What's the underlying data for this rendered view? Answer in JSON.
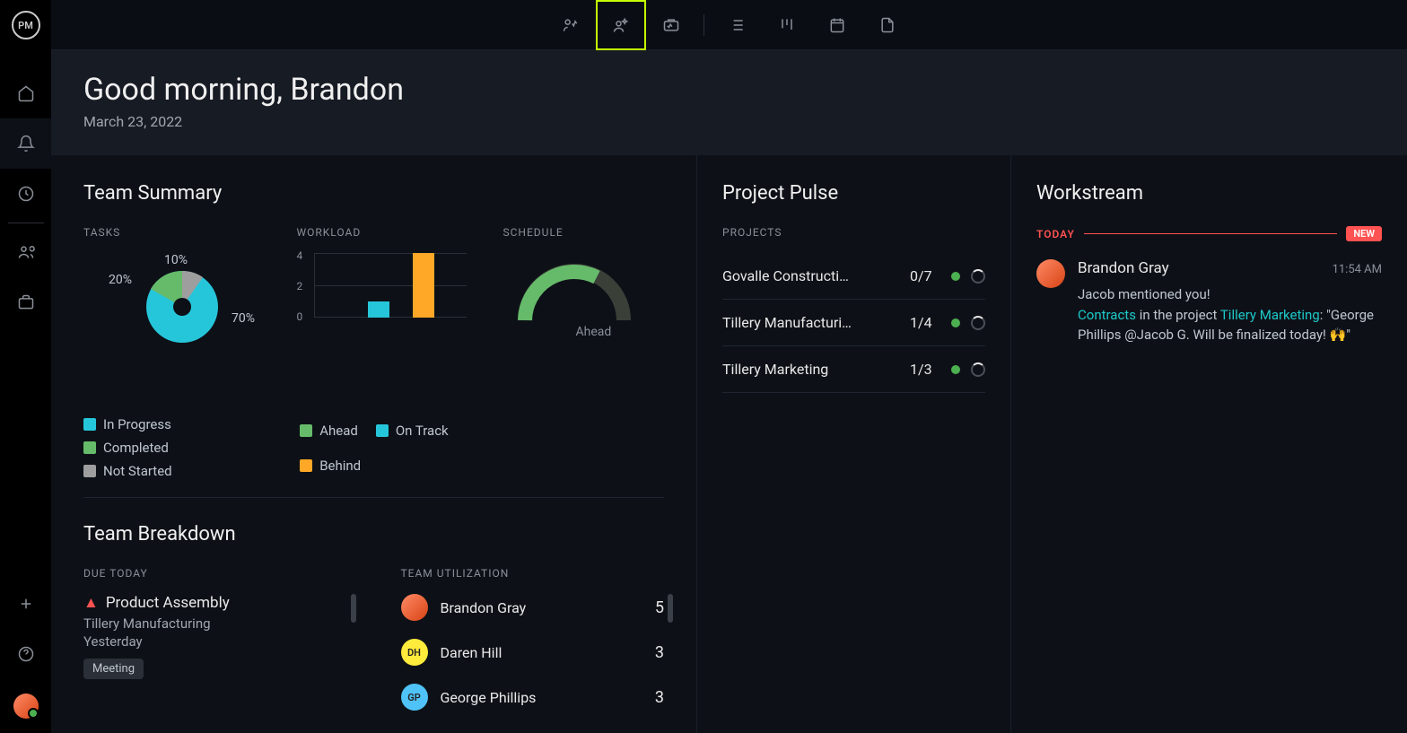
{
  "header": {
    "greeting": "Good morning, Brandon",
    "date": "March 23, 2022"
  },
  "sidebar": {
    "logo": "PM"
  },
  "team_summary": {
    "title": "Team Summary",
    "tasks_label": "TASKS",
    "workload_label": "WORKLOAD",
    "schedule_label": "SCHEDULE",
    "tasks_legend": [
      {
        "label": "In Progress",
        "color": "#26c6da"
      },
      {
        "label": "Completed",
        "color": "#66bb6a"
      },
      {
        "label": "Not Started",
        "color": "#9e9e9e"
      }
    ],
    "workload_legend": [
      {
        "label": "Ahead",
        "color": "#66bb6a"
      },
      {
        "label": "On Track",
        "color": "#26c6da"
      },
      {
        "label": "Behind",
        "color": "#ffa726"
      }
    ],
    "schedule_status": "Ahead"
  },
  "chart_data": {
    "tasks_pie": {
      "type": "pie",
      "slices": [
        {
          "label": "70%",
          "value": 70,
          "color": "#26c6da"
        },
        {
          "label": "20%",
          "value": 20,
          "color": "#66bb6a"
        },
        {
          "label": "10%",
          "value": 10,
          "color": "#9e9e9e"
        }
      ]
    },
    "workload_bar": {
      "type": "bar",
      "ylim": [
        0,
        4
      ],
      "yticks": [
        0,
        2,
        4
      ],
      "bars": [
        {
          "color": "#26c6da",
          "value": 1
        },
        {
          "color": "#ffa726",
          "value": 4
        }
      ]
    },
    "schedule_gauge": {
      "type": "gauge",
      "value": 0.6,
      "color_fill": "#66bb6a",
      "color_track": "#3a3f38"
    }
  },
  "team_breakdown": {
    "title": "Team Breakdown",
    "due_today_label": "DUE TODAY",
    "team_util_label": "TEAM UTILIZATION",
    "due": [
      {
        "title": "Product Assembly",
        "project": "Tillery Manufacturing",
        "when": "Yesterday",
        "tag": "Meeting",
        "warn": true
      }
    ],
    "util": [
      {
        "name": "Brandon Gray",
        "count": "5",
        "avatar_bg": "linear-gradient(135deg,#ff8a65 0%,#d84315 100%)",
        "initials": ""
      },
      {
        "name": "Daren Hill",
        "count": "3",
        "avatar_bg": "#ffeb3b",
        "initials": "DH"
      },
      {
        "name": "George Phillips",
        "count": "3",
        "avatar_bg": "#4fc3f7",
        "initials": "GP"
      }
    ]
  },
  "pulse": {
    "title": "Project Pulse",
    "subtitle": "PROJECTS",
    "projects": [
      {
        "name": "Govalle Constructi…",
        "count": "0/7"
      },
      {
        "name": "Tillery Manufacturi…",
        "count": "1/4"
      },
      {
        "name": "Tillery Marketing",
        "count": "1/3"
      }
    ]
  },
  "workstream": {
    "title": "Workstream",
    "today_label": "TODAY",
    "new_label": "NEW",
    "items": [
      {
        "author": "Brandon Gray",
        "time": "11:54 AM",
        "line1": "Jacob mentioned you!",
        "link1": "Contracts",
        "mid": " in the project ",
        "link2": "Tillery Marketing",
        "rest": ": \"George Phillips @Jacob G. Will be finalized today! 🙌\""
      }
    ]
  }
}
